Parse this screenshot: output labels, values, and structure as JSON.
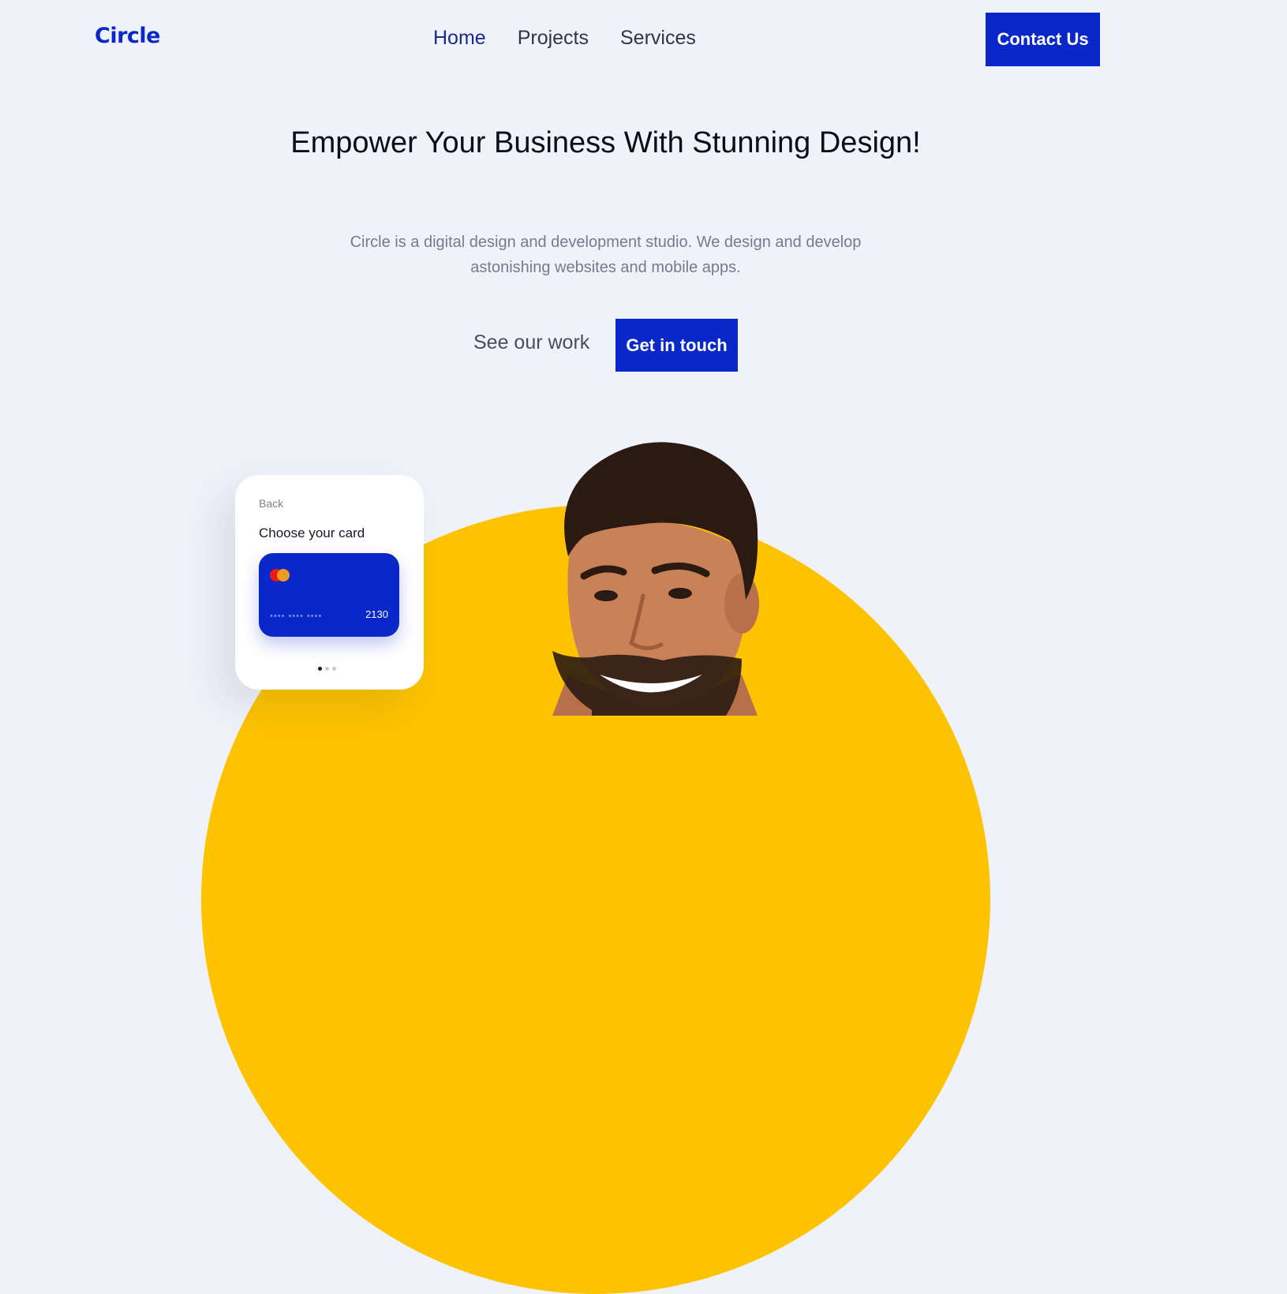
{
  "brand": {
    "name": "Circle",
    "color": "#0a27c9"
  },
  "nav": {
    "items": [
      {
        "label": "Home",
        "active": true
      },
      {
        "label": "Projects",
        "active": false
      },
      {
        "label": "Services",
        "active": false
      }
    ],
    "cta_label": "Contact Us"
  },
  "hero": {
    "title": "Empower Your Business With Stunning Design!",
    "subtitle": "Circle is a digital design and development studio. We design and develop astonishing websites and mobile apps.",
    "secondary_cta": "See our work",
    "primary_cta": "Get in touch"
  },
  "card_widget": {
    "back_label": "Back",
    "title": "Choose your card",
    "card_masked": "••••  ••••  ••••",
    "card_last4": "2130",
    "card_brand_icon": "mastercard-icon",
    "pager_total": 3,
    "pager_active": 1
  },
  "colors": {
    "accent": "#0a27c9",
    "background": "#f0f2fa",
    "highlight_yellow": "#fdc300"
  }
}
